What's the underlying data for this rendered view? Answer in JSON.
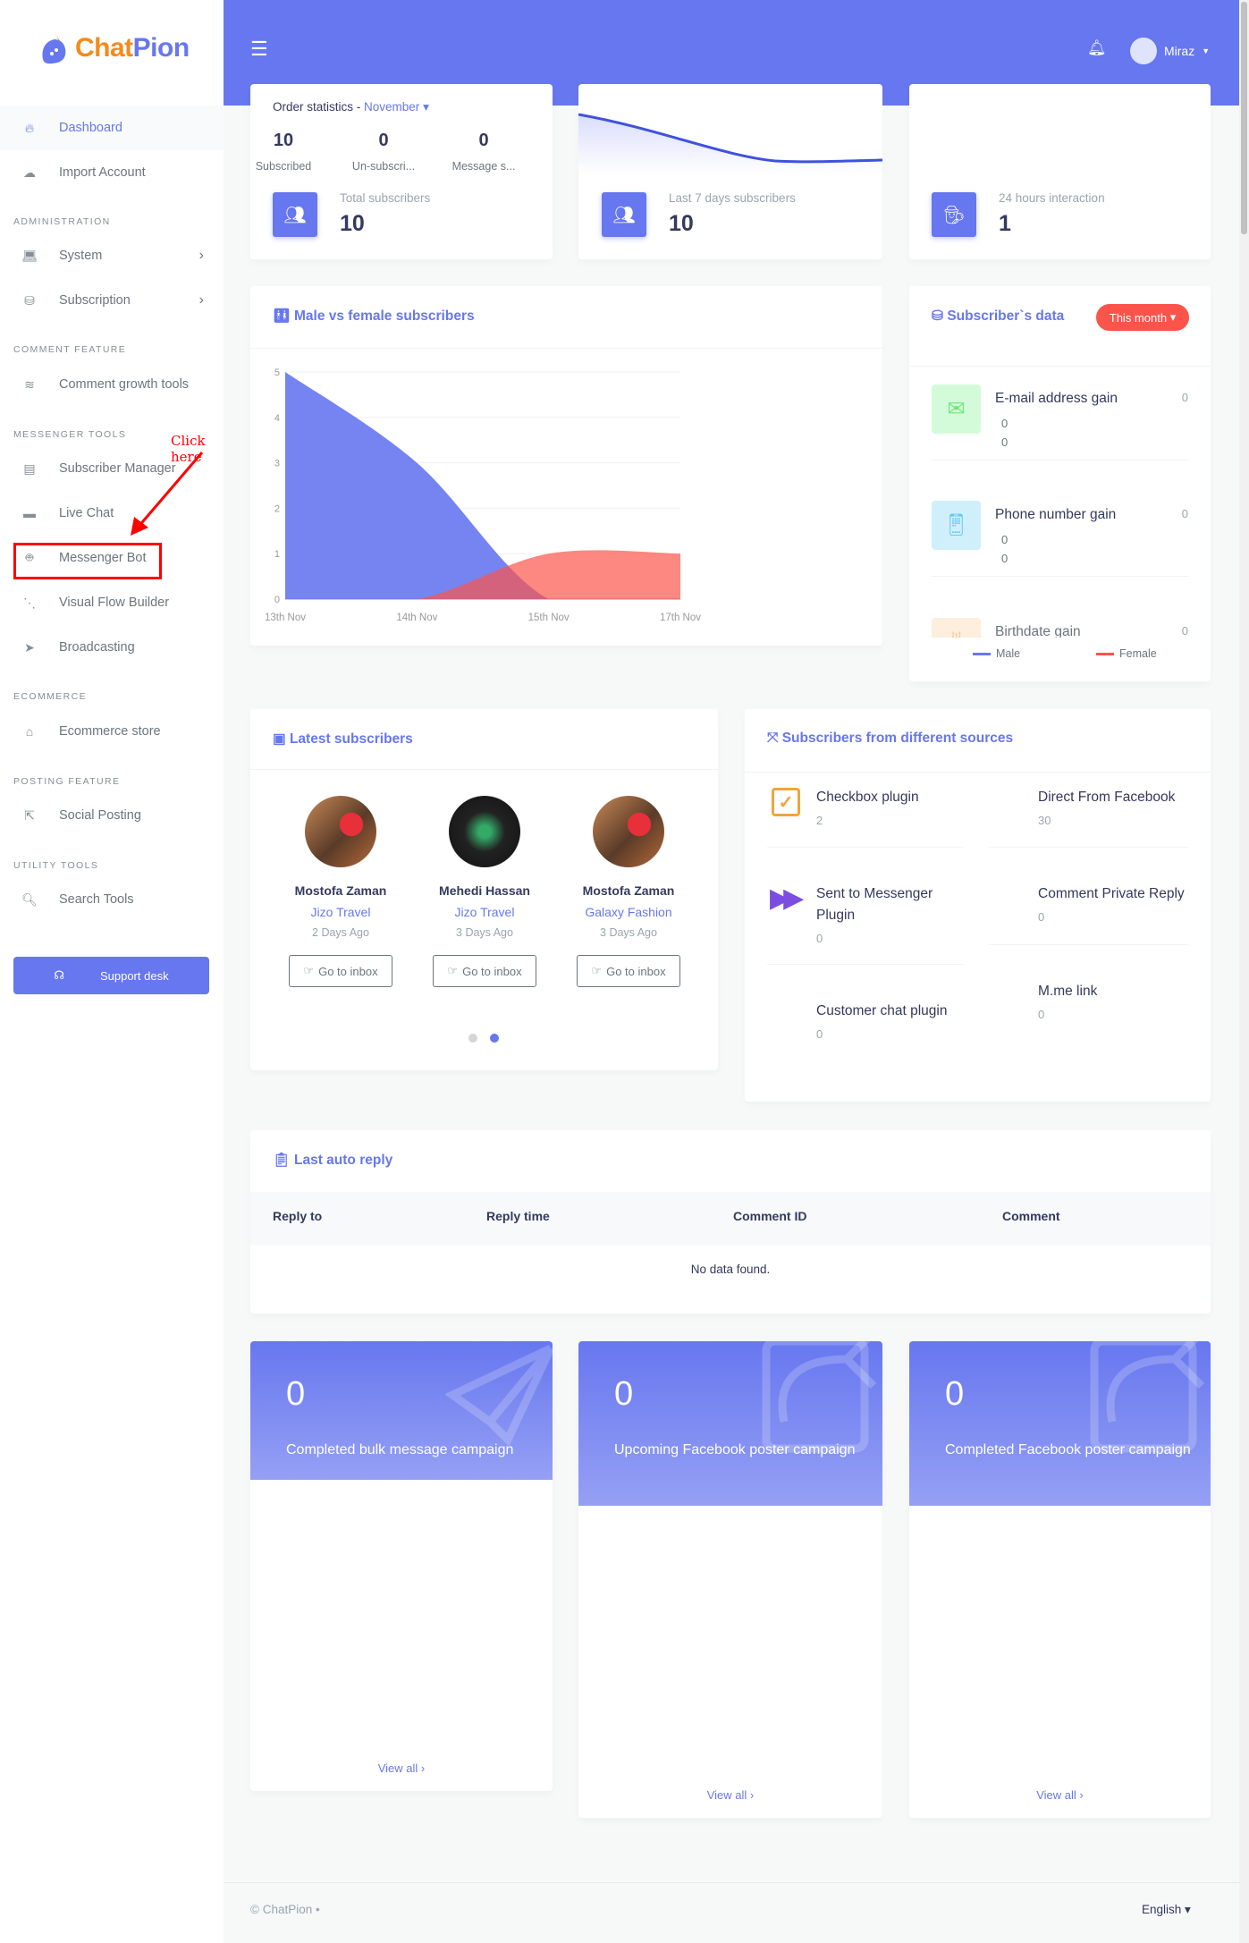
{
  "brand": {
    "name_a": "Chat",
    "name_b": "Pion"
  },
  "sidebar": {
    "items": [
      {
        "label": "Dashboard",
        "icon": "fire-icon"
      },
      {
        "label": "Import Account",
        "icon": "cloud-download-icon"
      },
      {
        "section": "ADMINISTRATION"
      },
      {
        "label": "System",
        "icon": "laptop-code-icon",
        "chevron": true
      },
      {
        "label": "Subscription",
        "icon": "coins-icon",
        "chevron": true
      },
      {
        "section": "COMMENT FEATURE"
      },
      {
        "label": "Comment growth tools",
        "icon": "layer-group-icon"
      },
      {
        "section": "MESSENGER TOOLS"
      },
      {
        "label": "Subscriber Manager",
        "icon": "address-card-icon"
      },
      {
        "label": "Live Chat",
        "icon": "comment-icon"
      },
      {
        "label": "Messenger Bot",
        "icon": "robot-icon"
      },
      {
        "label": "Visual Flow Builder",
        "icon": "project-diagram-icon"
      },
      {
        "label": "Broadcasting",
        "icon": "paper-plane-icon"
      },
      {
        "section": "ECOMMERCE"
      },
      {
        "label": "Ecommerce store",
        "icon": "store-icon"
      },
      {
        "section": "POSTING FEATURE"
      },
      {
        "label": "Social Posting",
        "icon": "share-square-icon"
      },
      {
        "section": "UTILITY TOOLS"
      },
      {
        "label": "Search Tools",
        "icon": "search-icon"
      }
    ],
    "support_label": "Support desk",
    "annotation": "Click here",
    "annotation_color": "#ff0000"
  },
  "header": {
    "user": "Miraz"
  },
  "order_stats": {
    "title": "Order statistics -",
    "month": "November",
    "stats": [
      {
        "value": "10",
        "label": "Subscribed"
      },
      {
        "value": "0",
        "label": "Un-subscri..."
      },
      {
        "value": "0",
        "label": "Message s..."
      }
    ],
    "total_label": "Total subscribers",
    "total_value": "10"
  },
  "last7": {
    "label": "Last 7 days subscribers",
    "value": "10"
  },
  "interaction": {
    "label": "24 hours interaction",
    "value": "1"
  },
  "gender_chart": {
    "title": "Male vs female subscribers"
  },
  "chart_data": {
    "type": "area",
    "categories": [
      "13th Nov",
      "14th Nov",
      "15th Nov",
      "17th Nov"
    ],
    "series": [
      {
        "name": "Male",
        "values": [
          5,
          3,
          0,
          0
        ],
        "color": "#6777ef"
      },
      {
        "name": "Female",
        "values": [
          0,
          0,
          1,
          1
        ],
        "color": "#fc544b"
      }
    ],
    "ylim": [
      0,
      5
    ],
    "yticks": [
      0,
      1,
      2,
      3,
      4,
      5
    ],
    "grid": true,
    "legend": "bottom"
  },
  "subscriber_data": {
    "title": "Subscriber`s data",
    "filter": "This month",
    "items": [
      {
        "title": "E-mail address gain",
        "v1": "0",
        "v2": "0",
        "right": "0",
        "icon": "envelope-icon"
      },
      {
        "title": "Phone number gain",
        "v1": "0",
        "v2": "0",
        "right": "0",
        "icon": "mobile-icon"
      },
      {
        "title": "Birthdate gain",
        "right": "0",
        "icon": "birthday-cake-icon"
      }
    ]
  },
  "latest": {
    "title": "Latest subscribers",
    "button": "Go to inbox",
    "subscribers": [
      {
        "name": "Mostofa Zaman",
        "page": "Jizo Travel",
        "time": "2 Days Ago"
      },
      {
        "name": "Mehedi Hassan",
        "page": "Jizo Travel",
        "time": "3 Days Ago"
      },
      {
        "name": "Mostofa Zaman",
        "page": "Galaxy Fashion",
        "time": "3 Days Ago"
      }
    ],
    "pages": 2,
    "active_page": 2
  },
  "sources": {
    "title": "Subscribers from different sources",
    "items": [
      {
        "title": "Checkbox plugin",
        "value": "2"
      },
      {
        "title": "Direct From Facebook",
        "value": "30"
      },
      {
        "title": "Sent to Messenger Plugin",
        "value": "0"
      },
      {
        "title": "Comment Private Reply",
        "value": "0"
      },
      {
        "title": "Customer chat plugin",
        "value": "0"
      },
      {
        "title": "M.me link",
        "value": "0"
      }
    ]
  },
  "auto_reply": {
    "title": "Last auto reply",
    "columns": [
      "Reply to",
      "Reply time",
      "Comment ID",
      "Comment"
    ],
    "empty": "No data found."
  },
  "campaigns": [
    {
      "value": "0",
      "label": "Completed bulk message campaign",
      "link": "View all"
    },
    {
      "value": "0",
      "label": "Upcoming Facebook poster campaign",
      "link": "View all"
    },
    {
      "value": "0",
      "label": "Completed Facebook poster campaign",
      "link": "View all"
    }
  ],
  "footer": {
    "copyright": "© ChatPion",
    "language": "English"
  }
}
